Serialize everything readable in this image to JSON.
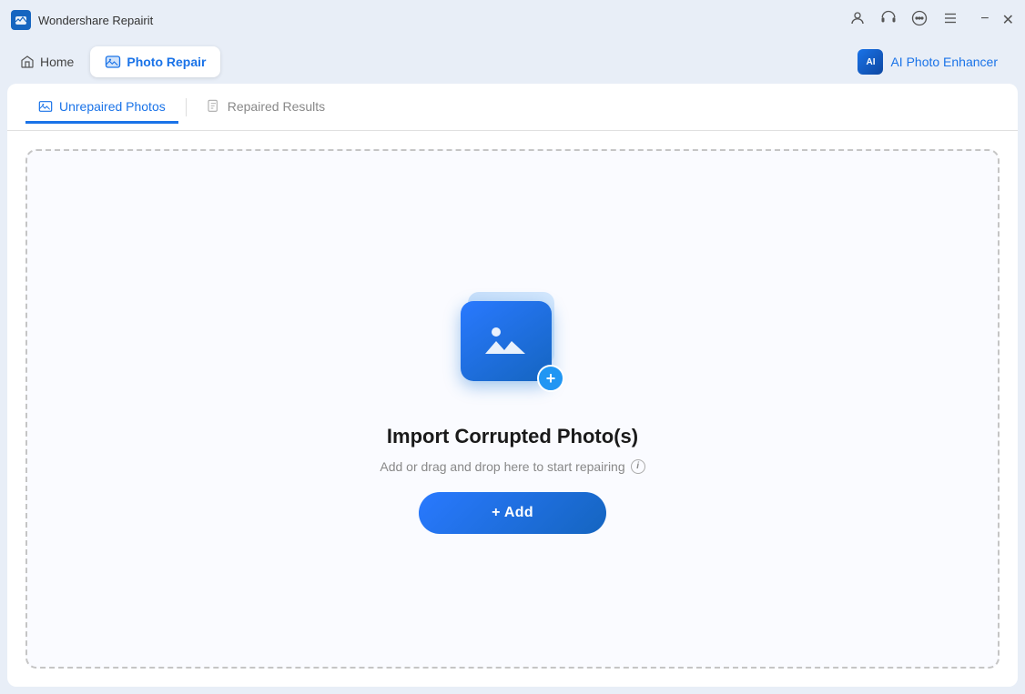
{
  "titlebar": {
    "app_name": "Wondershare Repairit",
    "icons": [
      "account-icon",
      "headset-icon",
      "chat-icon",
      "menu-icon"
    ],
    "minimize_label": "−",
    "close_label": "✕"
  },
  "navbar": {
    "home_label": "Home",
    "photo_repair_label": "Photo Repair",
    "ai_enhancer_label": "AI Photo Enhancer",
    "ai_badge_text": "AI"
  },
  "tabs": {
    "unrepaired_label": "Unrepaired Photos",
    "repaired_label": "Repaired Results"
  },
  "dropzone": {
    "title": "Import Corrupted Photo(s)",
    "subtitle": "Add or drag and drop here to start repairing",
    "add_button_label": "+ Add"
  }
}
